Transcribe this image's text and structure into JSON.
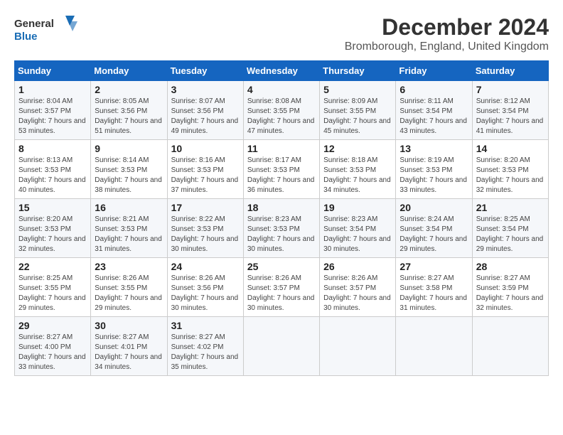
{
  "logo": {
    "line1": "General",
    "line2": "Blue"
  },
  "title": "December 2024",
  "subtitle": "Bromborough, England, United Kingdom",
  "days_of_week": [
    "Sunday",
    "Monday",
    "Tuesday",
    "Wednesday",
    "Thursday",
    "Friday",
    "Saturday"
  ],
  "weeks": [
    [
      {
        "day": "1",
        "sunrise": "8:04 AM",
        "sunset": "3:57 PM",
        "daylight": "7 hours and 53 minutes."
      },
      {
        "day": "2",
        "sunrise": "8:05 AM",
        "sunset": "3:56 PM",
        "daylight": "7 hours and 51 minutes."
      },
      {
        "day": "3",
        "sunrise": "8:07 AM",
        "sunset": "3:56 PM",
        "daylight": "7 hours and 49 minutes."
      },
      {
        "day": "4",
        "sunrise": "8:08 AM",
        "sunset": "3:55 PM",
        "daylight": "7 hours and 47 minutes."
      },
      {
        "day": "5",
        "sunrise": "8:09 AM",
        "sunset": "3:55 PM",
        "daylight": "7 hours and 45 minutes."
      },
      {
        "day": "6",
        "sunrise": "8:11 AM",
        "sunset": "3:54 PM",
        "daylight": "7 hours and 43 minutes."
      },
      {
        "day": "7",
        "sunrise": "8:12 AM",
        "sunset": "3:54 PM",
        "daylight": "7 hours and 41 minutes."
      }
    ],
    [
      {
        "day": "8",
        "sunrise": "8:13 AM",
        "sunset": "3:53 PM",
        "daylight": "7 hours and 40 minutes."
      },
      {
        "day": "9",
        "sunrise": "8:14 AM",
        "sunset": "3:53 PM",
        "daylight": "7 hours and 38 minutes."
      },
      {
        "day": "10",
        "sunrise": "8:16 AM",
        "sunset": "3:53 PM",
        "daylight": "7 hours and 37 minutes."
      },
      {
        "day": "11",
        "sunrise": "8:17 AM",
        "sunset": "3:53 PM",
        "daylight": "7 hours and 36 minutes."
      },
      {
        "day": "12",
        "sunrise": "8:18 AM",
        "sunset": "3:53 PM",
        "daylight": "7 hours and 34 minutes."
      },
      {
        "day": "13",
        "sunrise": "8:19 AM",
        "sunset": "3:53 PM",
        "daylight": "7 hours and 33 minutes."
      },
      {
        "day": "14",
        "sunrise": "8:20 AM",
        "sunset": "3:53 PM",
        "daylight": "7 hours and 32 minutes."
      }
    ],
    [
      {
        "day": "15",
        "sunrise": "8:20 AM",
        "sunset": "3:53 PM",
        "daylight": "7 hours and 32 minutes."
      },
      {
        "day": "16",
        "sunrise": "8:21 AM",
        "sunset": "3:53 PM",
        "daylight": "7 hours and 31 minutes."
      },
      {
        "day": "17",
        "sunrise": "8:22 AM",
        "sunset": "3:53 PM",
        "daylight": "7 hours and 30 minutes."
      },
      {
        "day": "18",
        "sunrise": "8:23 AM",
        "sunset": "3:53 PM",
        "daylight": "7 hours and 30 minutes."
      },
      {
        "day": "19",
        "sunrise": "8:23 AM",
        "sunset": "3:54 PM",
        "daylight": "7 hours and 30 minutes."
      },
      {
        "day": "20",
        "sunrise": "8:24 AM",
        "sunset": "3:54 PM",
        "daylight": "7 hours and 29 minutes."
      },
      {
        "day": "21",
        "sunrise": "8:25 AM",
        "sunset": "3:54 PM",
        "daylight": "7 hours and 29 minutes."
      }
    ],
    [
      {
        "day": "22",
        "sunrise": "8:25 AM",
        "sunset": "3:55 PM",
        "daylight": "7 hours and 29 minutes."
      },
      {
        "day": "23",
        "sunrise": "8:26 AM",
        "sunset": "3:55 PM",
        "daylight": "7 hours and 29 minutes."
      },
      {
        "day": "24",
        "sunrise": "8:26 AM",
        "sunset": "3:56 PM",
        "daylight": "7 hours and 30 minutes."
      },
      {
        "day": "25",
        "sunrise": "8:26 AM",
        "sunset": "3:57 PM",
        "daylight": "7 hours and 30 minutes."
      },
      {
        "day": "26",
        "sunrise": "8:26 AM",
        "sunset": "3:57 PM",
        "daylight": "7 hours and 30 minutes."
      },
      {
        "day": "27",
        "sunrise": "8:27 AM",
        "sunset": "3:58 PM",
        "daylight": "7 hours and 31 minutes."
      },
      {
        "day": "28",
        "sunrise": "8:27 AM",
        "sunset": "3:59 PM",
        "daylight": "7 hours and 32 minutes."
      }
    ],
    [
      {
        "day": "29",
        "sunrise": "8:27 AM",
        "sunset": "4:00 PM",
        "daylight": "7 hours and 33 minutes."
      },
      {
        "day": "30",
        "sunrise": "8:27 AM",
        "sunset": "4:01 PM",
        "daylight": "7 hours and 34 minutes."
      },
      {
        "day": "31",
        "sunrise": "8:27 AM",
        "sunset": "4:02 PM",
        "daylight": "7 hours and 35 minutes."
      },
      null,
      null,
      null,
      null
    ]
  ]
}
